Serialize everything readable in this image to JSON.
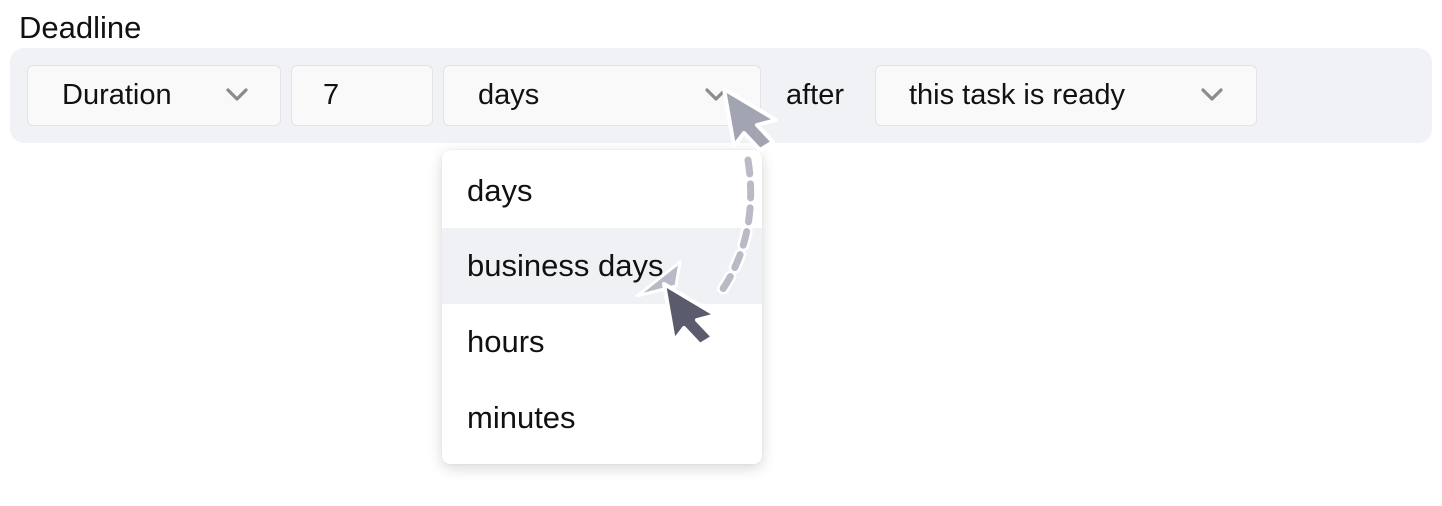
{
  "section": {
    "label": "Deadline"
  },
  "rule": {
    "mode": {
      "selected": "Duration",
      "icon": "chevron-down-icon"
    },
    "amount": {
      "value": "7"
    },
    "unit": {
      "selected": "days",
      "icon": "chevron-down-icon"
    },
    "connector": "after",
    "start": {
      "selected": "this task is ready",
      "icon": "chevron-down-icon"
    }
  },
  "unit_menu": {
    "items": [
      {
        "label": "days",
        "highlighted": false
      },
      {
        "label": "business days",
        "highlighted": true
      },
      {
        "label": "hours",
        "highlighted": false
      },
      {
        "label": "minutes",
        "highlighted": false
      }
    ]
  },
  "annotation": {
    "icons": [
      "cursor-arrow-icon",
      "dashed-curved-arrow-icon"
    ],
    "colors": {
      "cursor_start": "#a3a4b2",
      "cursor_end": "#5a5c6e",
      "path": "#b9bac6"
    }
  },
  "colors": {
    "bar_background": "#f1f2f6",
    "control_background": "#f9f9f9",
    "menu_highlight": "#f0f1f5",
    "chevron": "#8a8a8f"
  }
}
